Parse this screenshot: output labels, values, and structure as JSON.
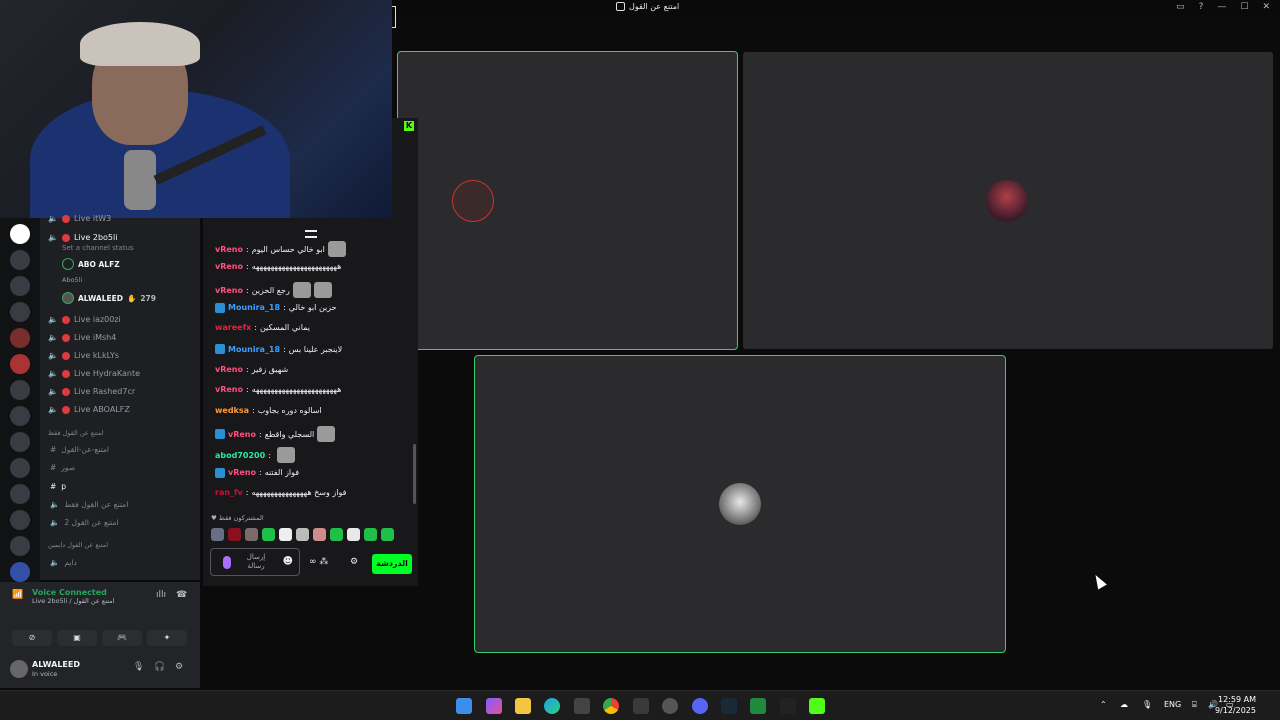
{
  "window": {
    "title": "امتنع عن القول"
  },
  "discord": {
    "channels": [
      {
        "label": "Live itW3",
        "live": true
      },
      {
        "label": "Live 2bo5li",
        "live": true,
        "active": true,
        "status": "Set a channel status"
      },
      {
        "label": "Live iaz00zi",
        "live": true
      },
      {
        "label": "Live iMsh4",
        "live": true
      },
      {
        "label": "Live kLkLYs",
        "live": true
      },
      {
        "label": "Live HydraKante",
        "live": true
      },
      {
        "label": "Live Rashed7cr",
        "live": true
      },
      {
        "label": "Live ABOALFZ",
        "live": true
      }
    ],
    "members": [
      {
        "name": "ABO ALFZ"
      },
      {
        "name": "Abo5li"
      },
      {
        "name": "ALWALEED",
        "count": "279"
      }
    ],
    "category1": "امتنع عن القول فقط",
    "text_channels1": [
      "امتنع-عن-القول",
      "صور",
      "p",
      "امتنع عن القول فقط",
      "امتنع عن القول 2"
    ],
    "category2": "امتنع عن القول دايمين",
    "text_channels2": [
      "دايم"
    ],
    "voice": {
      "status": "Voice Connected",
      "channel": "Live 2bo5li / امتنع عن القول"
    },
    "user": {
      "name": "ALWALEED",
      "status": "In voice"
    }
  },
  "chat": {
    "messages": [
      {
        "user": "vReno",
        "color": "#ff4f80",
        "text": "ابو خالي حساس اليوم",
        "emotes": 1,
        "badge": false
      },
      {
        "user": "vReno",
        "color": "#ff4f80",
        "text": "هههههههههههههههههههههههه",
        "emotes": 0,
        "badge": false
      },
      {
        "user": "vReno",
        "color": "#ff4f80",
        "text": "رجع الحزين",
        "emotes": 2,
        "badge": false
      },
      {
        "user": "Mounira_18",
        "color": "#3aa0ff",
        "text": "حزين ابو خالي",
        "emotes": 0,
        "badge": true
      },
      {
        "user": "wareefx",
        "color": "#e8213f",
        "text": "يماني المسكين",
        "emotes": 0,
        "badge": false
      },
      {
        "user": "Mounira_18",
        "color": "#3aa0ff",
        "text": "لاينجبر علينا بس",
        "emotes": 0,
        "badge": true
      },
      {
        "user": "vReno",
        "color": "#ff4f80",
        "text": "شهيق زفير",
        "emotes": 0,
        "badge": false
      },
      {
        "user": "vReno",
        "color": "#ff4f80",
        "text": "هههههههههههههههههههههههه",
        "emotes": 0,
        "badge": false
      },
      {
        "user": "wedksa",
        "color": "#ff9a3c",
        "text": "اسالوه دوره بجاوب",
        "emotes": 0,
        "badge": false
      },
      {
        "user": "vReno",
        "color": "#ff4f80",
        "text": "السجلي واقطع",
        "emotes": 1,
        "badge": true
      },
      {
        "user": "abod70200",
        "color": "#2ee6a0",
        "text": "",
        "emotes": 1,
        "badge": false
      },
      {
        "user": "vReno",
        "color": "#ff4f80",
        "text": "فواز الفتنه",
        "emotes": 0,
        "badge": true
      },
      {
        "user": "ran_fv",
        "color": "#c4123b",
        "text": "فواز وسخ هههههههههههههههه",
        "emotes": 0,
        "badge": false
      }
    ],
    "subs_label": "المشتركون فقط",
    "input_placeholder": "إرسال رسالة",
    "send_label": "الدردشة"
  },
  "taskbar": {
    "lang": "ENG",
    "time": "12:59 AM",
    "date": "9/12/2025"
  },
  "colors": {
    "speaking": "#3cce6c",
    "kick_green": "#53fc18",
    "live_red": "#e0393e"
  }
}
